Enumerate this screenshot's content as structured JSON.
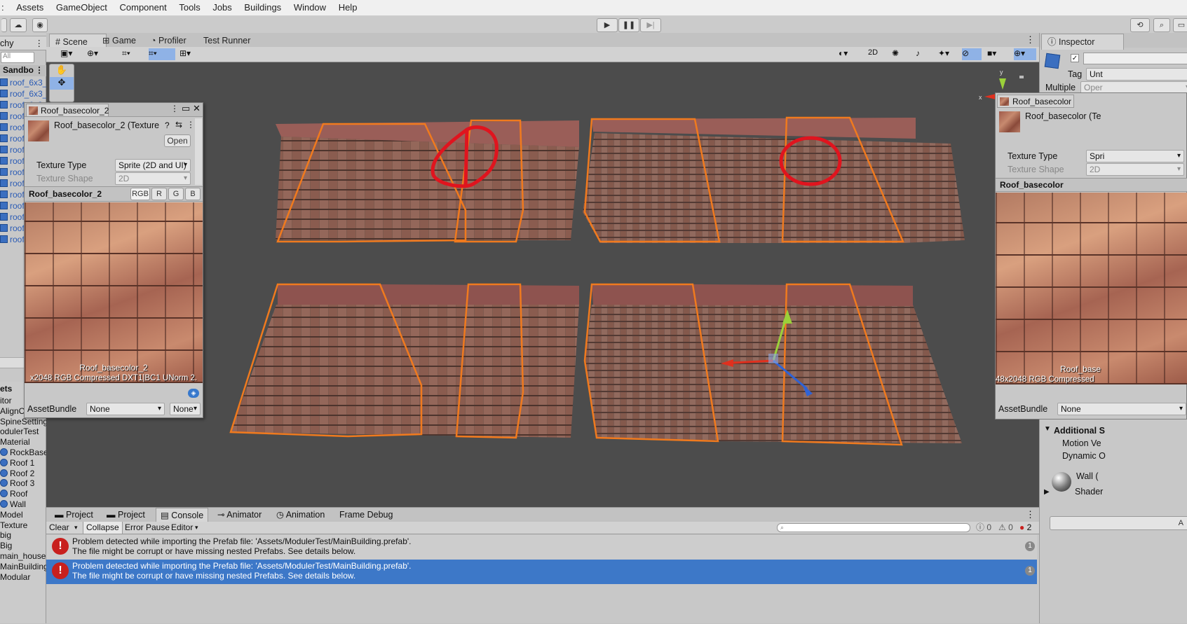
{
  "menu": [
    "Assets",
    "GameObject",
    "Component",
    "Tools",
    "Jobs",
    "Buildings",
    "Window",
    "Help"
  ],
  "scene_tabs": [
    {
      "label": "Scene",
      "icon": "grid-icon"
    },
    {
      "label": "Game",
      "icon": "gamepad-icon"
    },
    {
      "label": "Profiler",
      "icon": "profiler-icon"
    },
    {
      "label": "Test Runner",
      "icon": ""
    }
  ],
  "scene_toolbar": {
    "two_d": "2D"
  },
  "hierarchy": {
    "tab": "chy",
    "search_placeholder": "All",
    "root": "Sandbo",
    "items": [
      "roof_6x3_",
      "roof_6x3_",
      "roof_6x3_",
      "roof",
      "roof",
      "roof",
      "roof",
      "roof",
      "roof",
      "roof",
      "roof",
      "roof",
      "roof",
      "roof",
      "roof"
    ]
  },
  "project_list": {
    "header": "ets",
    "items": [
      "itor",
      "AlignC",
      "SpineSetting",
      "odulerTest",
      "Material",
      "RockBase",
      "Roof 1",
      "Roof 2",
      "Roof 3",
      "Roof",
      "Wall",
      "Model",
      "Texture",
      "big",
      "Big",
      "main_houses",
      "MainBuilding",
      "Modular"
    ]
  },
  "floating_inspector": {
    "tab": "Roof_basecolor_2",
    "asset_title": "Roof_basecolor_2 (Texture",
    "open_button": "Open",
    "texture_type_label": "Texture Type",
    "texture_type_value": "Sprite (2D and UI)",
    "texture_shape_label": "Texture Shape",
    "texture_shape_value": "2D",
    "preview_name": "Roof_basecolor_2",
    "channels": [
      "RGB",
      "R",
      "G",
      "B"
    ],
    "preview_caption_name": "Roof_basecolor_2",
    "preview_caption_info": "x2048  RGB Compressed DXT1|BC1 UNorm  2.",
    "assetbundle_label": "AssetBundle",
    "assetbundle_value": "None",
    "assetbundle_variant": "None"
  },
  "inspector": {
    "tab": "Inspector",
    "tag_label": "Tag",
    "tag_value": "Unt",
    "multiple": "Multiple",
    "open": "Oper",
    "sub_tab": "Roof_basecolor",
    "asset_title": "Roof_basecolor (Te",
    "texture_type_label": "Texture Type",
    "texture_type_value": "Spri",
    "texture_shape_label": "Texture Shape",
    "texture_shape_value": "2D",
    "preview_name": "Roof_basecolor",
    "caption_name": "Roof_base",
    "caption_info": "48x2048  RGB Compressed",
    "assetbundle_label": "AssetBundle",
    "assetbundle_value": "None",
    "additional_settings": "Additional S",
    "motion": "Motion Ve",
    "dynamic": "Dynamic O",
    "material": "Wall (",
    "shader": "Shader",
    "add_btn": "A"
  },
  "bottom_tabs": [
    {
      "label": "Project",
      "icon": "folder-icon"
    },
    {
      "label": "Project",
      "icon": "folder-icon"
    },
    {
      "label": "Console",
      "icon": "console-icon"
    },
    {
      "label": "Animator",
      "icon": "animator-icon"
    },
    {
      "label": "Animation",
      "icon": "animation-icon"
    },
    {
      "label": "Frame Debug",
      "icon": ""
    }
  ],
  "console": {
    "clear": "Clear",
    "collapse": "Collapse",
    "error_pause": "Error Pause",
    "editor": "Editor",
    "count_log": "0",
    "count_warn": "0",
    "count_error": "2",
    "messages": [
      {
        "line1": "Problem detected while importing the Prefab file: 'Assets/ModulerTest/MainBuilding.prefab'.",
        "line2": "The file might be corrupt or have missing nested Prefabs. See details below.",
        "count": "1",
        "selected": false
      },
      {
        "line1": "Problem detected while importing the Prefab file: 'Assets/ModulerTest/MainBuilding.prefab'.",
        "line2": "The file might be corrupt or have missing nested Prefabs. See details below.",
        "count": "1",
        "selected": true
      }
    ]
  },
  "colors": {
    "selection_orange": "#f07a1e",
    "annotation_red": "#e0141e",
    "scene_bg": "#4c4c4c",
    "console_selected": "#3d78c8",
    "error_red": "#c8201e"
  }
}
